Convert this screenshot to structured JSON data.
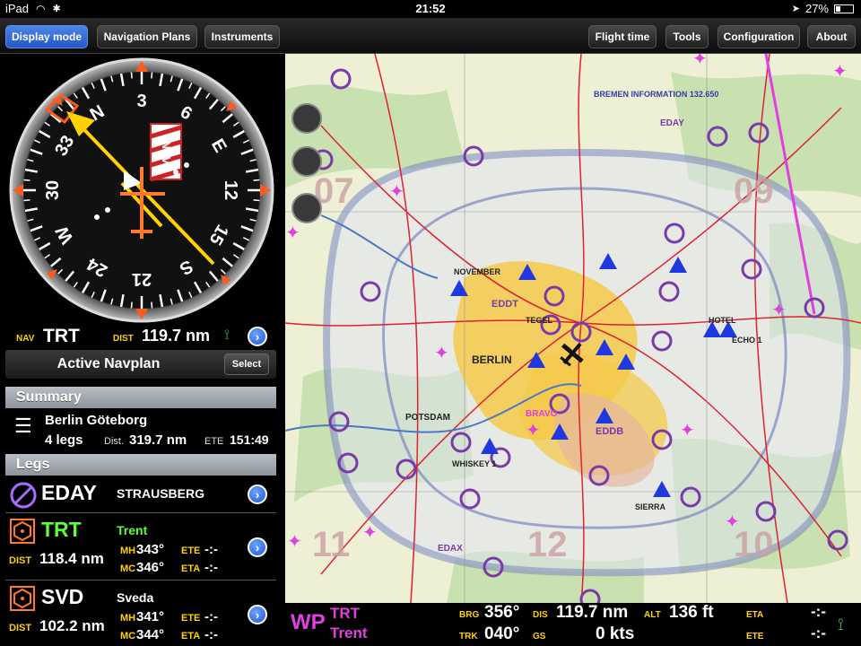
{
  "status": {
    "device": "iPad",
    "time": "21:52",
    "battery": "27%",
    "battery_level": 0.27
  },
  "toolbar": {
    "display_mode": "Display mode",
    "navigation_plans": "Navigation Plans",
    "instruments": "Instruments",
    "flight_time": "Flight time",
    "tools": "Tools",
    "configuration": "Configuration",
    "about": "About"
  },
  "hsi": {
    "heading_labels": [
      "N",
      "3",
      "6",
      "E",
      "12",
      "15",
      "S",
      "21",
      "24",
      "W",
      "30",
      "33"
    ],
    "nav_flag": "NAV"
  },
  "nav": {
    "label": "NAV",
    "ident": "TRT",
    "dist_label": "DIST",
    "dist": "119.7 nm"
  },
  "navplan": {
    "title": "Active Navplan",
    "select": "Select"
  },
  "summary": {
    "header": "Summary",
    "route": "Berlin Göteborg",
    "legs": "4 legs",
    "dist_label": "Dist.",
    "dist": "319.7 nm",
    "ete_label": "ETE",
    "ete": "151:49"
  },
  "legs": {
    "header": "Legs",
    "items": [
      {
        "ident": "EDAY",
        "name": "STRAUSBERG"
      },
      {
        "ident": "TRT",
        "name": "Trent",
        "dist_label": "DIST",
        "dist": "118.4 nm",
        "mh_label": "MH",
        "mh": "343°",
        "mc_label": "MC",
        "mc": "346°",
        "ete_label": "ETE",
        "ete": "-:-",
        "eta_label": "ETA",
        "eta": "-:-"
      },
      {
        "ident": "SVD",
        "name": "Sveda",
        "dist_label": "DIST",
        "dist": "102.2 nm",
        "mh_label": "MH",
        "mh": "341°",
        "mc_label": "MC",
        "mc": "344°",
        "ete_label": "ETE",
        "ete": "-:-",
        "eta_label": "ETA",
        "eta": "-:-"
      }
    ]
  },
  "map": {
    "labels": {
      "berlin": "BERLIN",
      "potsdam": "POTSDAM",
      "tegel": "TEGEL",
      "edtl": "EDDT",
      "eddb": "EDDB",
      "bremen": "BREMEN INFORMATION 132.650",
      "sect_07": "07",
      "sect_09": "09",
      "sect_11": "11",
      "sect_12": "12",
      "sect_10": "10",
      "november": "NOVEMBER",
      "whiskey": "WHISKEY 1",
      "sierra": "SIERRA",
      "echo": "ECHO 1",
      "hotel": "HOTEL",
      "bravo": "BRAVO",
      "eday": "EDAY",
      "edax": "EDAX"
    }
  },
  "infobar": {
    "wp_label": "WP",
    "wp_from": "TRT",
    "wp_to": "Trent",
    "brg_label": "BRG",
    "brg": "356°",
    "trk_label": "TRK",
    "trk": "040°",
    "dis_label": "DIS",
    "dis": "119.7 nm",
    "gs_label": "GS",
    "gs": "0 kts",
    "alt_label": "ALT",
    "alt": "136 ft",
    "eta_label": "ETA",
    "eta": "-:-",
    "ete_label": "ETE",
    "ete": "-:-"
  },
  "colors": {
    "accent": "#2f6bde",
    "label_yellow": "#ffd200",
    "wp_magenta": "#e040e0",
    "trt_green": "#5dff3a"
  }
}
